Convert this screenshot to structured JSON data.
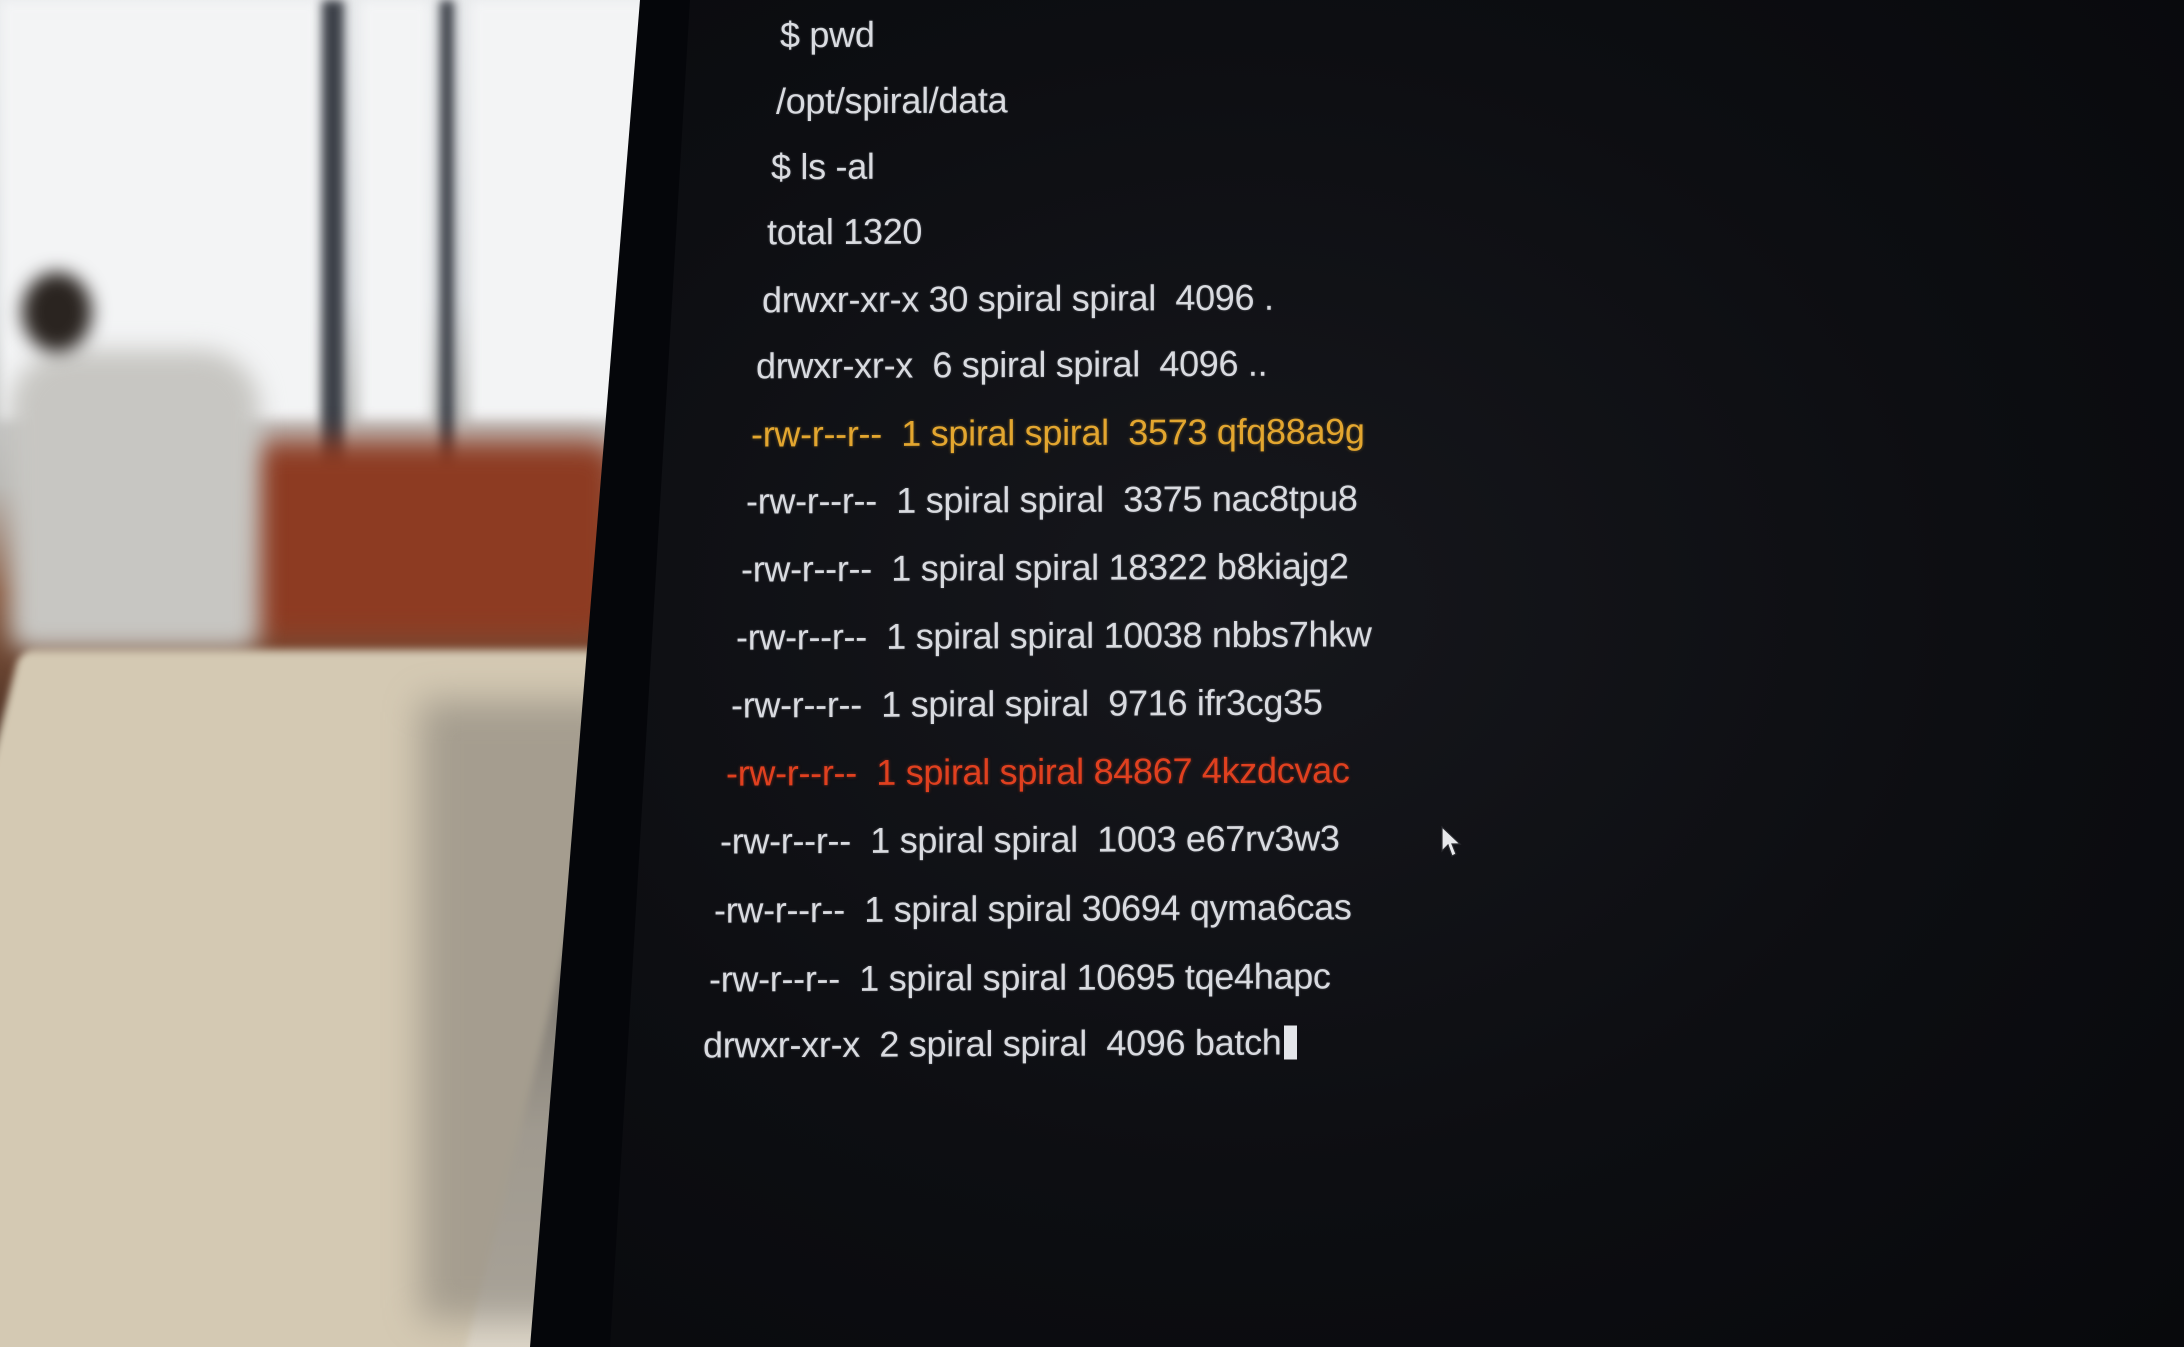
{
  "terminal": {
    "lines": [
      {
        "text": "$ pwd"
      },
      {
        "text": "/opt/spiral/data"
      },
      {
        "text": "$ ls -al"
      },
      {
        "text": "total 1320"
      },
      {
        "text": "drwxr-xr-x 30 spiral spiral  4096 ."
      },
      {
        "text": "drwxr-xr-x  6 spiral spiral  4096 .."
      },
      {
        "text": "-rw-r--r--  1 spiral spiral  3573 qfq88a9g",
        "color": "#e3a62f"
      },
      {
        "text": "-rw-r--r--  1 spiral spiral  3375 nac8tpu8"
      },
      {
        "text": "-rw-r--r--  1 spiral spiral 18322 b8kiajg2"
      },
      {
        "text": "-rw-r--r--  1 spiral spiral 10038 nbbs7hkw"
      },
      {
        "text": "-rw-r--r--  1 spiral spiral  9716 ifr3cg35"
      },
      {
        "text": "-rw-r--r--  1 spiral spiral 84867 4kzdcvac",
        "color": "#e0401f"
      },
      {
        "text": "-rw-r--r--  1 spiral spiral  1003 e67rv3w3"
      },
      {
        "text": "-rw-r--r--  1 spiral spiral 30694 qyma6cas"
      },
      {
        "text": "-rw-r--r--  1 spiral spiral 10695 tqe4hapc"
      },
      {
        "text": "drwxr-xr-x  2 spiral spiral  4096 batch"
      }
    ]
  },
  "colors": {
    "screen_background": "#0d0e12",
    "text": "#d9dbe0",
    "highlight_warning": "#e3a62f",
    "highlight_alert": "#e0401f"
  },
  "icons": {
    "cursor": "text-cursor-block",
    "pointer": "mouse-pointer-icon"
  }
}
